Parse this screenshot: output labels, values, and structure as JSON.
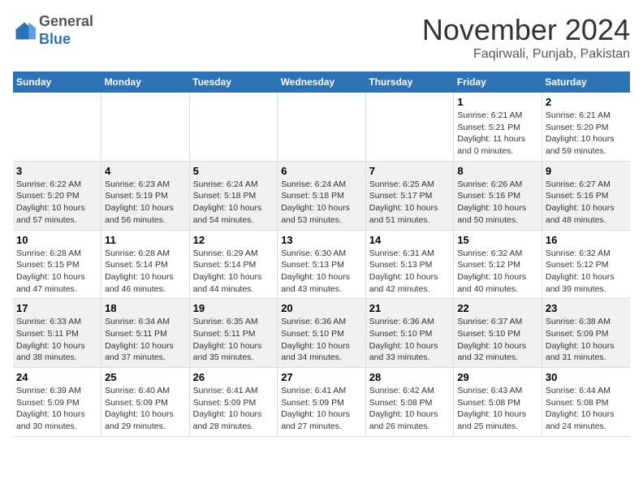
{
  "header": {
    "logo_line1": "General",
    "logo_line2": "Blue",
    "month": "November 2024",
    "location": "Faqirwali, Punjab, Pakistan"
  },
  "weekdays": [
    "Sunday",
    "Monday",
    "Tuesday",
    "Wednesday",
    "Thursday",
    "Friday",
    "Saturday"
  ],
  "weeks": [
    [
      {
        "day": "",
        "info": ""
      },
      {
        "day": "",
        "info": ""
      },
      {
        "day": "",
        "info": ""
      },
      {
        "day": "",
        "info": ""
      },
      {
        "day": "",
        "info": ""
      },
      {
        "day": "1",
        "info": "Sunrise: 6:21 AM\nSunset: 5:21 PM\nDaylight: 11 hours and 0 minutes."
      },
      {
        "day": "2",
        "info": "Sunrise: 6:21 AM\nSunset: 5:20 PM\nDaylight: 10 hours and 59 minutes."
      }
    ],
    [
      {
        "day": "3",
        "info": "Sunrise: 6:22 AM\nSunset: 5:20 PM\nDaylight: 10 hours and 57 minutes."
      },
      {
        "day": "4",
        "info": "Sunrise: 6:23 AM\nSunset: 5:19 PM\nDaylight: 10 hours and 56 minutes."
      },
      {
        "day": "5",
        "info": "Sunrise: 6:24 AM\nSunset: 5:18 PM\nDaylight: 10 hours and 54 minutes."
      },
      {
        "day": "6",
        "info": "Sunrise: 6:24 AM\nSunset: 5:18 PM\nDaylight: 10 hours and 53 minutes."
      },
      {
        "day": "7",
        "info": "Sunrise: 6:25 AM\nSunset: 5:17 PM\nDaylight: 10 hours and 51 minutes."
      },
      {
        "day": "8",
        "info": "Sunrise: 6:26 AM\nSunset: 5:16 PM\nDaylight: 10 hours and 50 minutes."
      },
      {
        "day": "9",
        "info": "Sunrise: 6:27 AM\nSunset: 5:16 PM\nDaylight: 10 hours and 48 minutes."
      }
    ],
    [
      {
        "day": "10",
        "info": "Sunrise: 6:28 AM\nSunset: 5:15 PM\nDaylight: 10 hours and 47 minutes."
      },
      {
        "day": "11",
        "info": "Sunrise: 6:28 AM\nSunset: 5:14 PM\nDaylight: 10 hours and 46 minutes."
      },
      {
        "day": "12",
        "info": "Sunrise: 6:29 AM\nSunset: 5:14 PM\nDaylight: 10 hours and 44 minutes."
      },
      {
        "day": "13",
        "info": "Sunrise: 6:30 AM\nSunset: 5:13 PM\nDaylight: 10 hours and 43 minutes."
      },
      {
        "day": "14",
        "info": "Sunrise: 6:31 AM\nSunset: 5:13 PM\nDaylight: 10 hours and 42 minutes."
      },
      {
        "day": "15",
        "info": "Sunrise: 6:32 AM\nSunset: 5:12 PM\nDaylight: 10 hours and 40 minutes."
      },
      {
        "day": "16",
        "info": "Sunrise: 6:32 AM\nSunset: 5:12 PM\nDaylight: 10 hours and 39 minutes."
      }
    ],
    [
      {
        "day": "17",
        "info": "Sunrise: 6:33 AM\nSunset: 5:11 PM\nDaylight: 10 hours and 38 minutes."
      },
      {
        "day": "18",
        "info": "Sunrise: 6:34 AM\nSunset: 5:11 PM\nDaylight: 10 hours and 37 minutes."
      },
      {
        "day": "19",
        "info": "Sunrise: 6:35 AM\nSunset: 5:11 PM\nDaylight: 10 hours and 35 minutes."
      },
      {
        "day": "20",
        "info": "Sunrise: 6:36 AM\nSunset: 5:10 PM\nDaylight: 10 hours and 34 minutes."
      },
      {
        "day": "21",
        "info": "Sunrise: 6:36 AM\nSunset: 5:10 PM\nDaylight: 10 hours and 33 minutes."
      },
      {
        "day": "22",
        "info": "Sunrise: 6:37 AM\nSunset: 5:10 PM\nDaylight: 10 hours and 32 minutes."
      },
      {
        "day": "23",
        "info": "Sunrise: 6:38 AM\nSunset: 5:09 PM\nDaylight: 10 hours and 31 minutes."
      }
    ],
    [
      {
        "day": "24",
        "info": "Sunrise: 6:39 AM\nSunset: 5:09 PM\nDaylight: 10 hours and 30 minutes."
      },
      {
        "day": "25",
        "info": "Sunrise: 6:40 AM\nSunset: 5:09 PM\nDaylight: 10 hours and 29 minutes."
      },
      {
        "day": "26",
        "info": "Sunrise: 6:41 AM\nSunset: 5:09 PM\nDaylight: 10 hours and 28 minutes."
      },
      {
        "day": "27",
        "info": "Sunrise: 6:41 AM\nSunset: 5:09 PM\nDaylight: 10 hours and 27 minutes."
      },
      {
        "day": "28",
        "info": "Sunrise: 6:42 AM\nSunset: 5:08 PM\nDaylight: 10 hours and 26 minutes."
      },
      {
        "day": "29",
        "info": "Sunrise: 6:43 AM\nSunset: 5:08 PM\nDaylight: 10 hours and 25 minutes."
      },
      {
        "day": "30",
        "info": "Sunrise: 6:44 AM\nSunset: 5:08 PM\nDaylight: 10 hours and 24 minutes."
      }
    ]
  ]
}
